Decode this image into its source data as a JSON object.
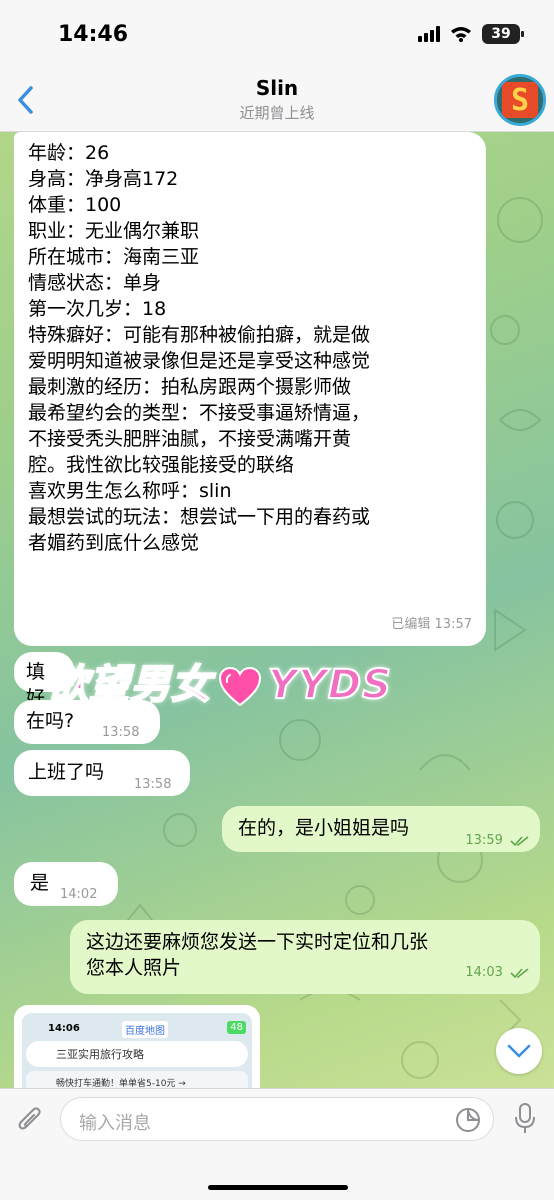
{
  "status": {
    "time": "14:46",
    "battery": "39"
  },
  "header": {
    "title": "Slin",
    "subtitle": "近期曾上线",
    "avatar_letter": "S"
  },
  "profile": {
    "lines": [
      "年龄：26",
      "身高：净身高172",
      "体重：100",
      "职业：无业偶尔兼职",
      "所在城市：海南三亚",
      "情感状态：单身",
      "第一次几岁：18",
      "特殊癖好：可能有那种被偷拍癖，就是做",
      "爱明明知道被录像但是还是享受这种感觉",
      "最刺激的经历：拍私房跟两个摄影师做",
      "最希望约会的类型：不接受事逼矫情逼，",
      "不接受秃头肥胖油腻，不接受满嘴开黄",
      "腔。我性欲比较强能接受的联络",
      "喜欢男生怎么称呼：slin",
      "最想尝试的玩法：想尝试一下用的春药或",
      "者媚药到底什么感觉"
    ],
    "edited": "已编辑",
    "time": "13:57"
  },
  "watermark": {
    "left": "欲望男女",
    "right": "YYDS"
  },
  "messages": [
    {
      "text": "填好",
      "time": "",
      "dir": "in"
    },
    {
      "text": "在吗?",
      "time": "13:58",
      "dir": "in"
    },
    {
      "text": "上班了吗",
      "time": "13:58",
      "dir": "in"
    },
    {
      "text": "在的，是小姐姐是吗",
      "time": "13:59",
      "dir": "out"
    },
    {
      "text": "是",
      "time": "14:02",
      "dir": "in"
    },
    {
      "text": "这边还要麻烦您发送一下实时定位和几张",
      "text2": "您本人照片",
      "time": "14:03",
      "dir": "out"
    }
  ],
  "thumbnail": {
    "time": "14:06",
    "label": "百度地图",
    "search": "三亚实用旅行攻略",
    "strip": "畅快打车通勤！单单省5-10元 →",
    "battery": "48"
  },
  "input": {
    "placeholder": "输入消息"
  },
  "colors": {
    "incoming": "#ffffff",
    "outgoing": "#e3f8c9",
    "accent": "#3a90e0",
    "tick": "#5fa54c"
  }
}
